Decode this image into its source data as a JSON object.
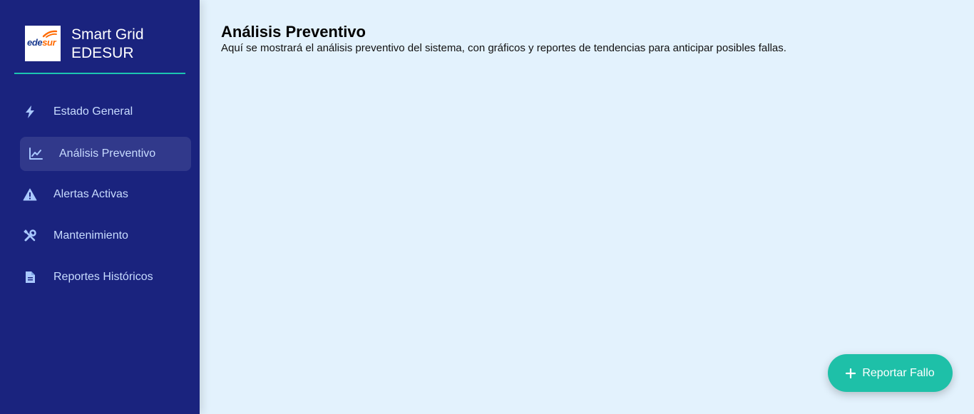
{
  "sidebar": {
    "brand": {
      "logo_part1": "ede",
      "logo_part2": "sur",
      "title_line1": "Smart Grid",
      "title_line2": "EDESUR"
    },
    "items": [
      {
        "label": "Estado General",
        "icon": "bolt-icon",
        "active": false
      },
      {
        "label": "Análisis Preventivo",
        "icon": "chart-line-icon",
        "active": true
      },
      {
        "label": "Alertas Activas",
        "icon": "warning-icon",
        "active": false
      },
      {
        "label": "Mantenimiento",
        "icon": "tools-icon",
        "active": false
      },
      {
        "label": "Reportes Históricos",
        "icon": "document-icon",
        "active": false
      }
    ]
  },
  "main": {
    "title": "Análisis Preventivo",
    "description": "Aquí se mostrará el análisis preventivo del sistema, con gráficos y reportes de tendencias para anticipar posibles fallas."
  },
  "fab": {
    "label": "Reportar Fallo",
    "icon": "plus-icon"
  },
  "colors": {
    "sidebar_bg": "#1a237e",
    "accent_teal": "#1ec0a8",
    "main_bg": "#e3f2fd",
    "logo_blue": "#1a3a8f",
    "logo_orange": "#ff6a00"
  }
}
